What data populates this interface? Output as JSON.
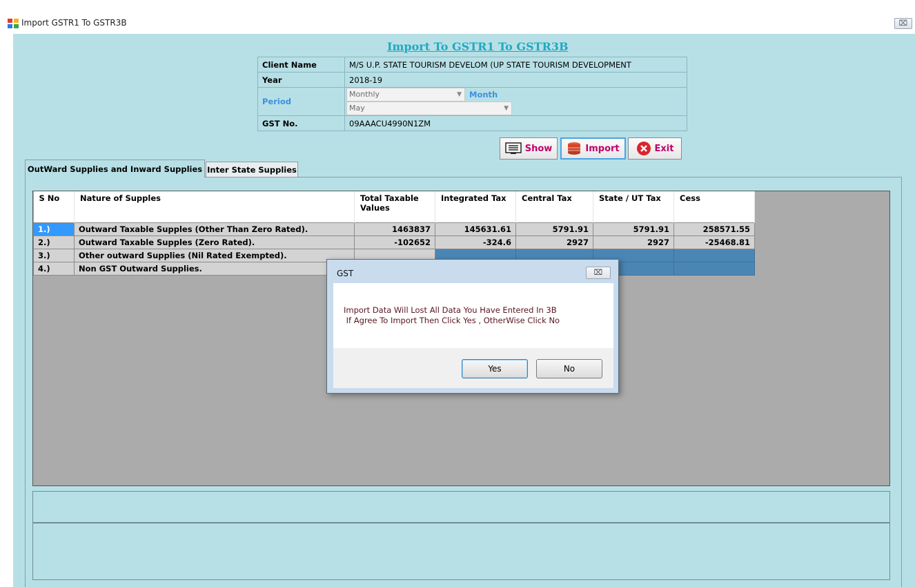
{
  "window": {
    "title": "Import GSTR1 To GSTR3B",
    "close_glyph": "⌧"
  },
  "form": {
    "heading": "Import To GSTR1 To GSTR3B",
    "client_name_label": "Client Name",
    "client_name_value": "M/S U.P. STATE TOURISM DEVELOM (UP STATE TOURISM DEVELOPMENT",
    "year_label": "Year",
    "year_value": "2018-19",
    "period_label": "Period",
    "period_value": "Monthly",
    "month_label": "Month",
    "month_value": "May",
    "gst_label": "GST No.",
    "gst_value": "09AAACU4990N1ZM"
  },
  "toolbar": {
    "show_label": "Show",
    "import_label": "Import",
    "exit_label": "Exit"
  },
  "tabs": [
    {
      "label": "OutWard Supplies and Inward Supplies"
    },
    {
      "label": "Inter State Supplies"
    }
  ],
  "grid": {
    "headers": [
      "S No",
      "Nature of Supples",
      "Total Taxable Values",
      "Integrated Tax",
      "Central Tax",
      "State / UT Tax",
      "Cess"
    ],
    "rows": [
      {
        "sno": "1.)",
        "nature": "Outward Taxable Supples (Other Than Zero Rated).",
        "taxable": "1463837",
        "igst": "145631.61",
        "cgst": "5791.91",
        "sgst": "5791.91",
        "cess": "258571.55"
      },
      {
        "sno": "2.)",
        "nature": "Outward Taxable Supples (Zero Rated).",
        "taxable": "-102652",
        "igst": "-324.6",
        "cgst": "2927",
        "sgst": "2927",
        "cess": "-25468.81"
      },
      {
        "sno": "3.)",
        "nature": "Other outward Supplies (Nil Rated Exempted).",
        "taxable": "",
        "igst": "",
        "cgst": "",
        "sgst": "",
        "cess": ""
      },
      {
        "sno": "4.)",
        "nature": "Non GST Outward Supplies.",
        "taxable": "",
        "igst": "",
        "cgst": "",
        "sgst": "",
        "cess": ""
      }
    ]
  },
  "dialog": {
    "title": "GST",
    "close_glyph": "⌧",
    "line1": "Import Data Will Lost All Data You Have Entered In 3B",
    "line2": " If Agree To Import Then Click Yes , OtherWise Click No",
    "yes_label": "Yes",
    "no_label": "No"
  },
  "colors": {
    "form_background": "#b7e0e6",
    "heading": "#20a9c1",
    "button_text": "#c0006b",
    "label_blue": "#3d8fe0",
    "selection": "#3399ff"
  }
}
